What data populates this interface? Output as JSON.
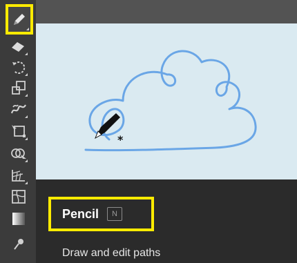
{
  "toolbar": {
    "tools": [
      {
        "icon": "pencil-icon",
        "selected": true
      },
      {
        "icon": "eraser-icon"
      },
      {
        "icon": "rotate-icon"
      },
      {
        "icon": "scale-icon"
      },
      {
        "icon": "warp-icon"
      },
      {
        "icon": "free-transform-icon"
      },
      {
        "icon": "shape-builder-icon"
      },
      {
        "icon": "perspective-grid-icon"
      },
      {
        "icon": "mesh-icon"
      },
      {
        "icon": "gradient-icon"
      }
    ]
  },
  "tooltip": {
    "title": "Pencil",
    "shortcut": "N",
    "description": "Draw and edit paths"
  },
  "colors": {
    "highlight": "#ffeb00",
    "path_stroke": "#6aa6e6",
    "canvas_bg": "#daeaf1",
    "panel_bg": "#2b2b2b"
  }
}
